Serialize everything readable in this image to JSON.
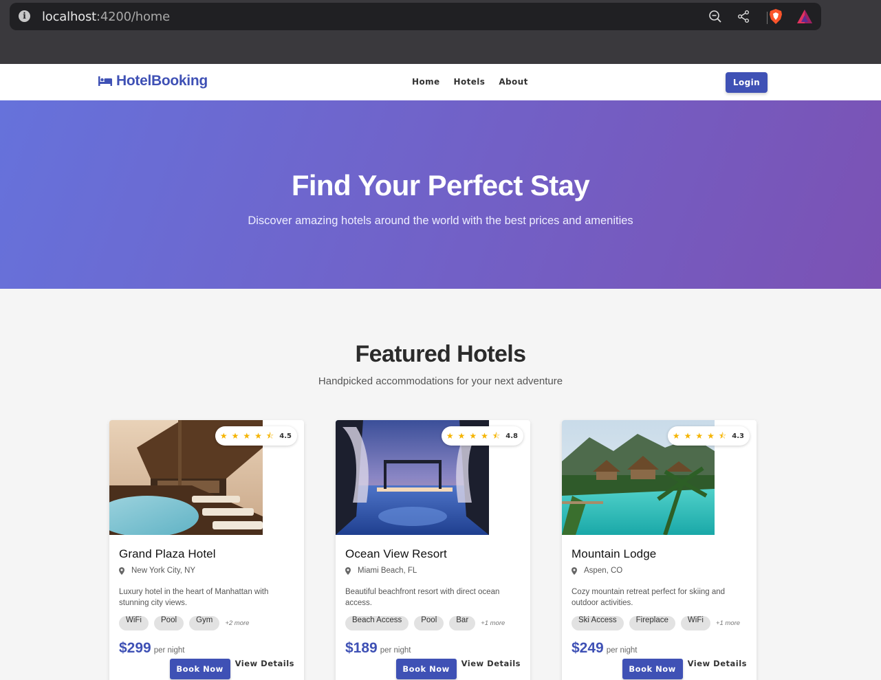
{
  "browser": {
    "url_host": "localhost",
    "url_path": ":4200/home",
    "icons": [
      "info-icon",
      "zoom-icon",
      "share-icon",
      "brave-shield-icon",
      "brave-rewards-icon"
    ]
  },
  "navbar": {
    "brand": "HotelBooking",
    "brand_icon": "hotel-bed-icon",
    "links": [
      "Home",
      "Hotels",
      "About"
    ],
    "login_label": "Login"
  },
  "hero": {
    "title": "Find Your Perfect Stay",
    "subtitle": "Discover amazing hotels around the world with the best prices and amenities"
  },
  "featured": {
    "title": "Featured Hotels",
    "subtitle": "Handpicked accommodations for your next adventure"
  },
  "hotels": [
    {
      "name": "Grand Plaza Hotel",
      "rating": "4.5",
      "location": "New York City, NY",
      "description": "Luxury hotel in the heart of Manhattan with stunning city views.",
      "amenities": [
        "WiFi",
        "Pool",
        "Gym"
      ],
      "more": "+2 more",
      "price": "$299",
      "per": "per night",
      "book_label": "Book Now",
      "details_label": "View Details"
    },
    {
      "name": "Ocean View Resort",
      "rating": "4.8",
      "location": "Miami Beach, FL",
      "description": "Beautiful beachfront resort with direct ocean access.",
      "amenities": [
        "Beach Access",
        "Pool",
        "Bar"
      ],
      "more": "+1 more",
      "price": "$189",
      "per": "per night",
      "book_label": "Book Now",
      "details_label": "View Details"
    },
    {
      "name": "Mountain Lodge",
      "rating": "4.3",
      "location": "Aspen, CO",
      "description": "Cozy mountain retreat perfect for skiing and outdoor activities.",
      "amenities": [
        "Ski Access",
        "Fireplace",
        "WiFi"
      ],
      "more": "+1 more",
      "price": "$249",
      "per": "per night",
      "book_label": "Book Now",
      "details_label": "View Details"
    }
  ],
  "colors": {
    "primary": "#3f51b5",
    "hero_start": "#6672db",
    "hero_end": "#7b52b4",
    "star": "#f5b400"
  }
}
